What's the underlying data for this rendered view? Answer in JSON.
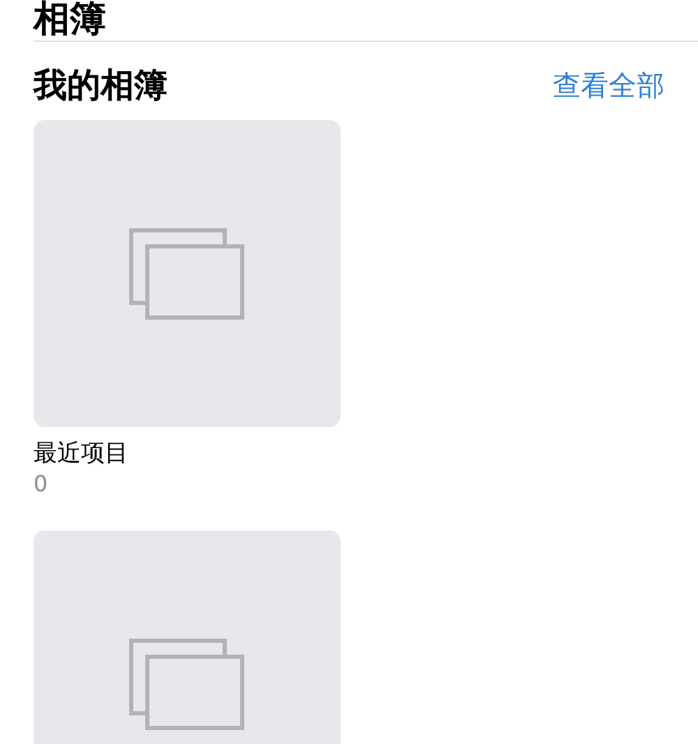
{
  "page_title": "相簿",
  "section": {
    "title": "我的相簿",
    "action": "查看全部"
  },
  "albums": [
    {
      "kind": "album",
      "name": "最近项目",
      "count": "0"
    },
    {
      "kind": "album"
    }
  ]
}
